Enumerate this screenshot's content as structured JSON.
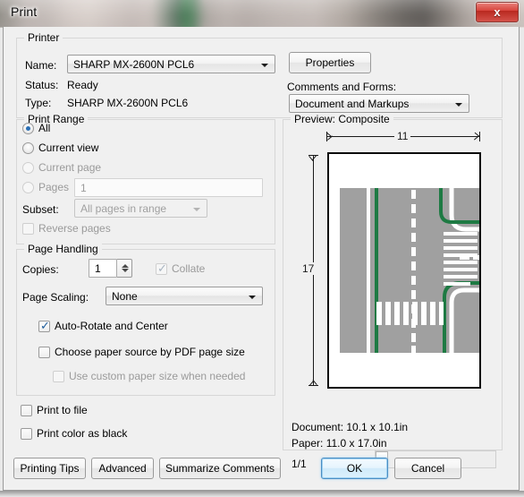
{
  "window": {
    "title": "Print",
    "close_label": "x"
  },
  "printer": {
    "legend": "Printer",
    "name_label": "Name:",
    "name_value": "SHARP MX-2600N PCL6",
    "status_label": "Status:",
    "status_value": "Ready",
    "type_label": "Type:",
    "type_value": "SHARP MX-2600N PCL6",
    "properties_label": "Properties",
    "comments_label": "Comments and Forms:",
    "comments_value": "Document and Markups"
  },
  "print_range": {
    "legend": "Print Range",
    "all_label": "All",
    "current_view_label": "Current view",
    "current_page_label": "Current page",
    "pages_label": "Pages",
    "pages_value": "1",
    "subset_label": "Subset:",
    "subset_value": "All pages in range",
    "reverse_label": "Reverse pages"
  },
  "page_handling": {
    "legend": "Page Handling",
    "copies_label": "Copies:",
    "copies_value": "1",
    "collate_label": "Collate",
    "scaling_label": "Page Scaling:",
    "scaling_value": "None",
    "auto_rotate_label": "Auto-Rotate and Center",
    "choose_source_label": "Choose paper source by PDF page size",
    "custom_paper_label": "Use custom paper size when needed"
  },
  "options": {
    "print_to_file_label": "Print to file",
    "print_color_black_label": "Print color as black"
  },
  "preview": {
    "legend": "Preview: Composite",
    "width_dim": "11",
    "height_dim": "17",
    "document_size": "Document: 10.1 x 10.1in",
    "paper_size": "Paper: 11.0 x 17.0in",
    "page_counter": "1/1"
  },
  "footer": {
    "printing_tips_label": "Printing Tips",
    "advanced_label": "Advanced",
    "summarize_label": "Summarize Comments",
    "ok_label": "OK",
    "cancel_label": "Cancel"
  },
  "colors": {
    "asphalt": "#a0a0a0",
    "marking": "#ffffff",
    "greenline": "#1e7a43",
    "paper": "#ffffff",
    "accent": "#2a6fb5",
    "close_red": "#d8443c"
  }
}
